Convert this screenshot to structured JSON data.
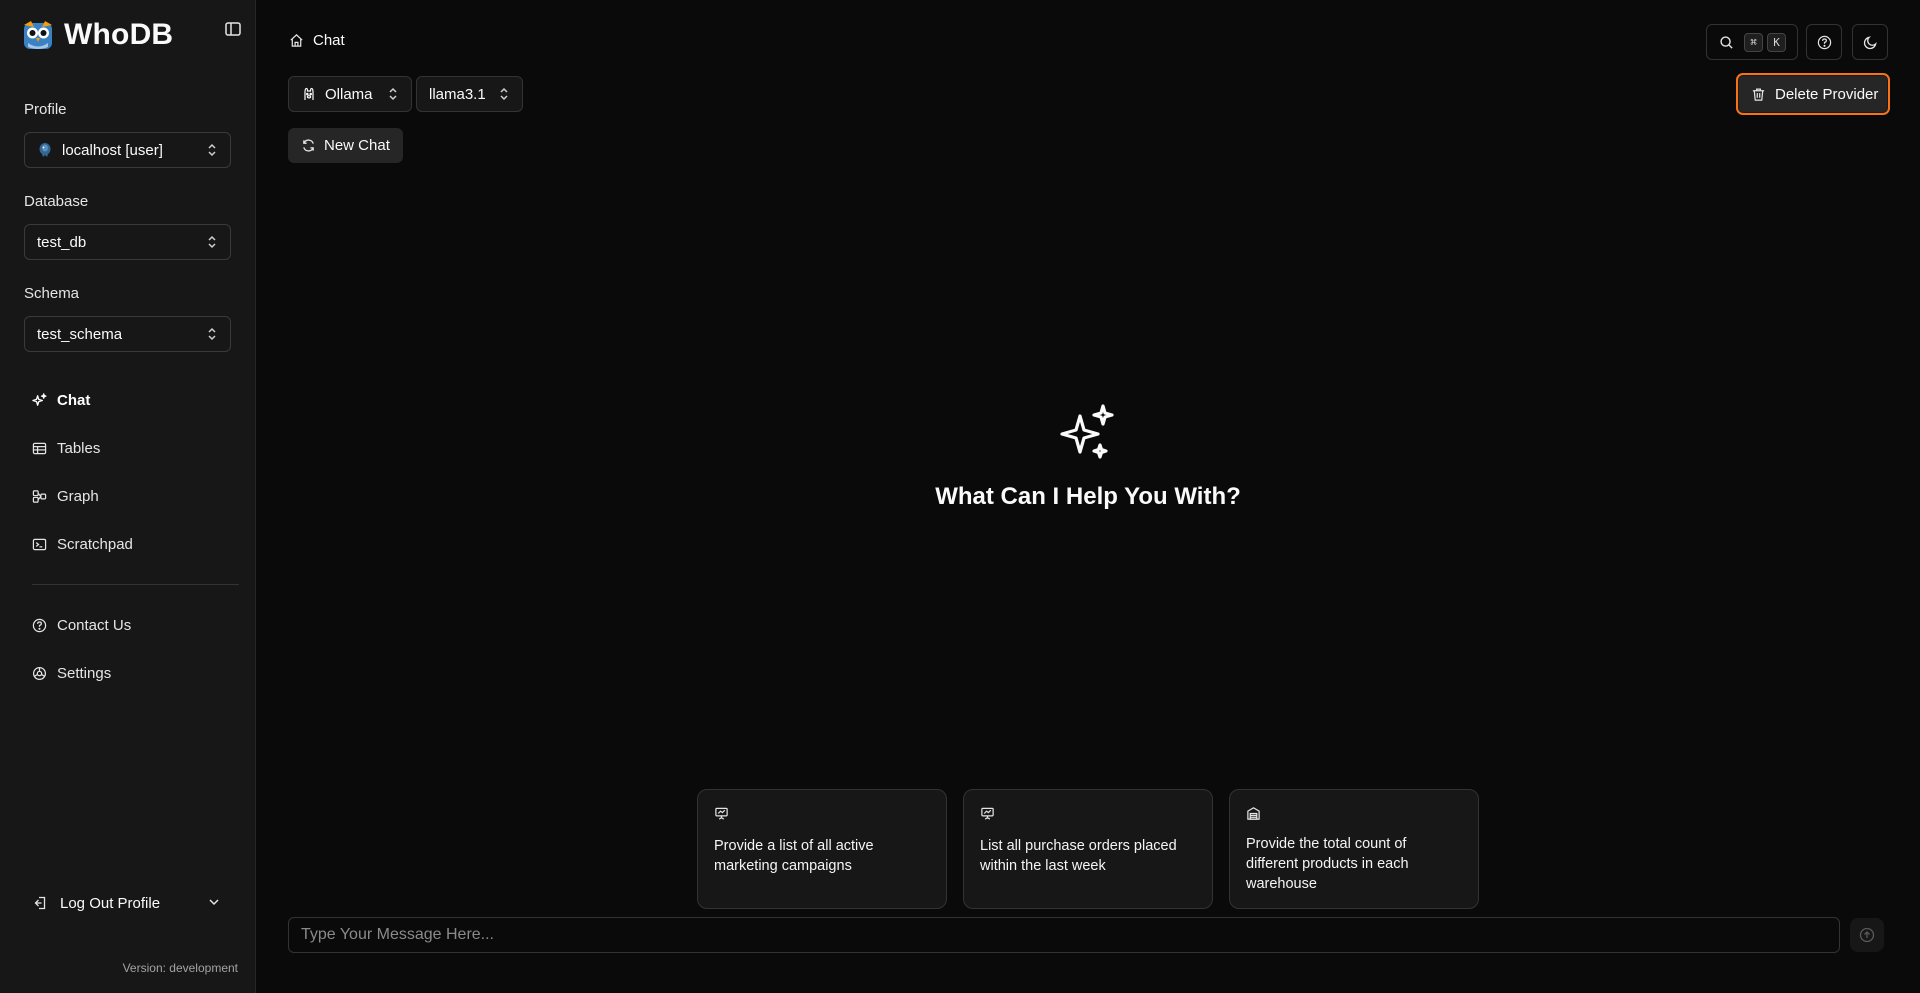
{
  "app": {
    "name": "WhoDB"
  },
  "sidebar": {
    "profile_label": "Profile",
    "profile_value": "localhost [user]",
    "database_label": "Database",
    "database_value": "test_db",
    "schema_label": "Schema",
    "schema_value": "test_schema",
    "nav": [
      {
        "label": "Chat",
        "icon": "sparkles-icon",
        "active": true
      },
      {
        "label": "Tables",
        "icon": "table-icon"
      },
      {
        "label": "Graph",
        "icon": "graph-icon"
      },
      {
        "label": "Scratchpad",
        "icon": "terminal-icon"
      }
    ],
    "secondary_nav": [
      {
        "label": "Contact Us",
        "icon": "help-circle-icon"
      },
      {
        "label": "Settings",
        "icon": "settings-icon"
      }
    ],
    "logout_label": "Log Out Profile",
    "version": "Version: development"
  },
  "header": {
    "breadcrumb": "Chat",
    "shortcut_keys": [
      "⌘",
      "K"
    ]
  },
  "toolbar": {
    "provider": "Ollama",
    "model": "llama3.1",
    "new_chat": "New Chat",
    "delete_provider": "Delete Provider"
  },
  "hero": {
    "title": "What Can I Help You With?"
  },
  "suggestions": [
    {
      "text": "Provide a list of all active marketing campaigns",
      "icon": "presentation-icon"
    },
    {
      "text": "List all purchase orders placed within the last week",
      "icon": "presentation-icon"
    },
    {
      "text": "Provide the total count of different products in each warehouse",
      "icon": "warehouse-icon"
    }
  ],
  "composer": {
    "placeholder": "Type Your Message Here..."
  },
  "colors": {
    "background": "#0a0a0a",
    "sidebar": "#171717",
    "accent_focus": "#f97316"
  }
}
